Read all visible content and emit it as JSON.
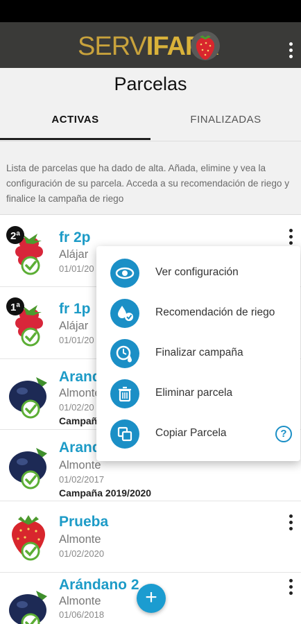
{
  "app": {
    "logo_text_1": "SERV",
    "logo_text_2": "IFAPA"
  },
  "page": {
    "title": "Parcelas"
  },
  "tabs": [
    {
      "label": "ACTIVAS",
      "active": true
    },
    {
      "label": "FINALIZADAS",
      "active": false
    }
  ],
  "intro_text": "Lista de parcelas que ha dado de alta. Añada, elimine y vea la configuración de su parcela. Acceda a su recomendación de riego y finalice la campaña de riego",
  "parcels": [
    {
      "name": "fr 2p",
      "place": "Alájar",
      "date": "01/01/20",
      "badge": "2ª",
      "crop": "raspberry-icon",
      "campaign": ""
    },
    {
      "name": "fr 1p",
      "place": "Alájar",
      "date": "01/01/20",
      "badge": "1ª",
      "crop": "raspberry-icon",
      "campaign": ""
    },
    {
      "name": "Arand",
      "place": "Almonte",
      "date": "01/02/20",
      "badge": "",
      "crop": "blueberry-icon",
      "campaign": "Campañ"
    },
    {
      "name": "Arand",
      "place": "Almonte",
      "date": "01/02/2017",
      "badge": "",
      "crop": "blueberry-icon",
      "campaign": "Campaña 2019/2020"
    },
    {
      "name": "Prueba",
      "place": "Almonte",
      "date": "01/02/2020",
      "badge": "",
      "crop": "strawberry-icon",
      "campaign": ""
    },
    {
      "name": "Arándano 2",
      "place": "Almonte",
      "date": "01/06/2018",
      "badge": "",
      "crop": "blueberry-icon",
      "campaign": ""
    }
  ],
  "context_menu": {
    "items": [
      {
        "label": "Ver configuración",
        "icon": "view-config-icon"
      },
      {
        "label": "Recomendación de riego",
        "icon": "irrigation-recommendation-icon"
      },
      {
        "label": "Finalizar campaña",
        "icon": "finish-campaign-icon"
      },
      {
        "label": "Eliminar parcela",
        "icon": "trash-icon"
      },
      {
        "label": "Copiar Parcela",
        "icon": "copy-icon"
      }
    ],
    "help_glyph": "?"
  },
  "fab": {
    "glyph": "+",
    "icon": "add-icon"
  },
  "colors": {
    "accent": "#1b8fc6",
    "title_link": "#1d9bc7",
    "appbar": "#3a3a38",
    "logo_gold": "#d9b23a"
  }
}
